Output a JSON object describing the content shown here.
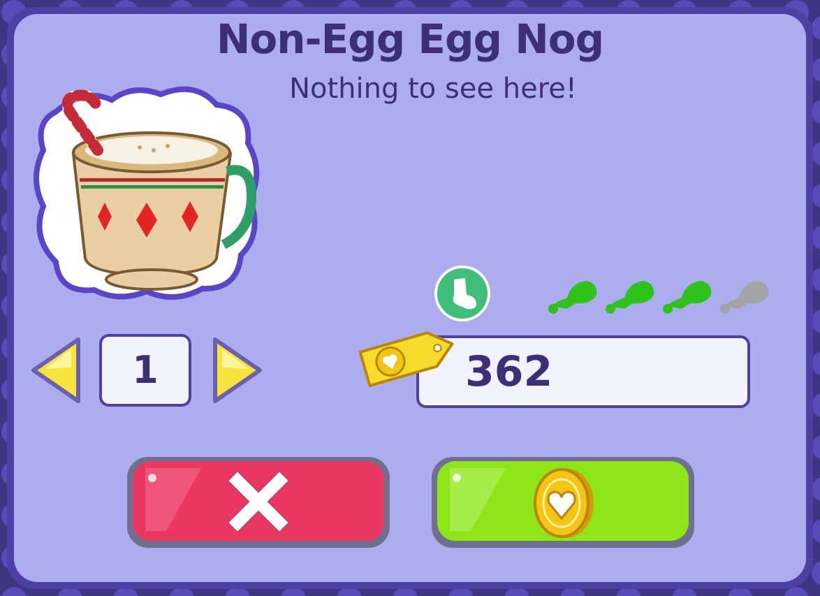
{
  "item": {
    "title": "Non-Egg Egg Nog",
    "subtitle": "Nothing to see here!",
    "image_icon": "egg-nog-mug-icon"
  },
  "stats": {
    "category_icon": "sock-icon",
    "hunger_icon": "drumstick-icon",
    "hunger_filled": 3,
    "hunger_max": 4
  },
  "quantity": {
    "value": "1",
    "decrease_icon": "arrow-left-icon",
    "increase_icon": "arrow-right-icon"
  },
  "price": {
    "value": "362",
    "tag_icon": "price-tag-icon"
  },
  "actions": {
    "cancel_icon": "close-icon",
    "buy_icon": "coin-icon"
  },
  "colors": {
    "panel": "#acadee",
    "frame": "#4e3fa3",
    "text": "#3d2f76",
    "cancel": "#ea3863",
    "buy": "#8ee619",
    "leg_filled": "#2fc21a",
    "leg_empty": "#a3a3a3",
    "coin": "#f5c516"
  }
}
